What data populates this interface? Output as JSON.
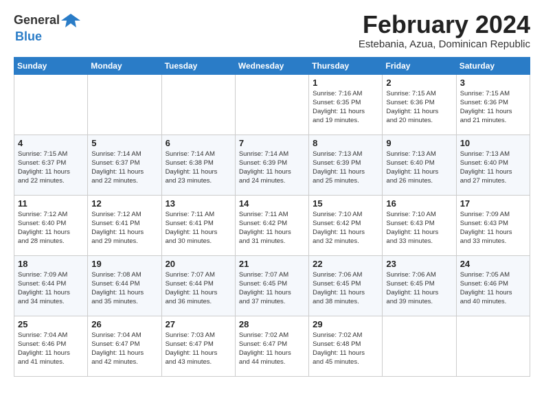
{
  "header": {
    "logo_line1": "General",
    "logo_line2": "Blue",
    "month": "February 2024",
    "location": "Estebania, Azua, Dominican Republic"
  },
  "days_of_week": [
    "Sunday",
    "Monday",
    "Tuesday",
    "Wednesday",
    "Thursday",
    "Friday",
    "Saturday"
  ],
  "weeks": [
    [
      {
        "day": "",
        "info": ""
      },
      {
        "day": "",
        "info": ""
      },
      {
        "day": "",
        "info": ""
      },
      {
        "day": "",
        "info": ""
      },
      {
        "day": "1",
        "info": "Sunrise: 7:16 AM\nSunset: 6:35 PM\nDaylight: 11 hours\nand 19 minutes."
      },
      {
        "day": "2",
        "info": "Sunrise: 7:15 AM\nSunset: 6:36 PM\nDaylight: 11 hours\nand 20 minutes."
      },
      {
        "day": "3",
        "info": "Sunrise: 7:15 AM\nSunset: 6:36 PM\nDaylight: 11 hours\nand 21 minutes."
      }
    ],
    [
      {
        "day": "4",
        "info": "Sunrise: 7:15 AM\nSunset: 6:37 PM\nDaylight: 11 hours\nand 22 minutes."
      },
      {
        "day": "5",
        "info": "Sunrise: 7:14 AM\nSunset: 6:37 PM\nDaylight: 11 hours\nand 22 minutes."
      },
      {
        "day": "6",
        "info": "Sunrise: 7:14 AM\nSunset: 6:38 PM\nDaylight: 11 hours\nand 23 minutes."
      },
      {
        "day": "7",
        "info": "Sunrise: 7:14 AM\nSunset: 6:39 PM\nDaylight: 11 hours\nand 24 minutes."
      },
      {
        "day": "8",
        "info": "Sunrise: 7:13 AM\nSunset: 6:39 PM\nDaylight: 11 hours\nand 25 minutes."
      },
      {
        "day": "9",
        "info": "Sunrise: 7:13 AM\nSunset: 6:40 PM\nDaylight: 11 hours\nand 26 minutes."
      },
      {
        "day": "10",
        "info": "Sunrise: 7:13 AM\nSunset: 6:40 PM\nDaylight: 11 hours\nand 27 minutes."
      }
    ],
    [
      {
        "day": "11",
        "info": "Sunrise: 7:12 AM\nSunset: 6:40 PM\nDaylight: 11 hours\nand 28 minutes."
      },
      {
        "day": "12",
        "info": "Sunrise: 7:12 AM\nSunset: 6:41 PM\nDaylight: 11 hours\nand 29 minutes."
      },
      {
        "day": "13",
        "info": "Sunrise: 7:11 AM\nSunset: 6:41 PM\nDaylight: 11 hours\nand 30 minutes."
      },
      {
        "day": "14",
        "info": "Sunrise: 7:11 AM\nSunset: 6:42 PM\nDaylight: 11 hours\nand 31 minutes."
      },
      {
        "day": "15",
        "info": "Sunrise: 7:10 AM\nSunset: 6:42 PM\nDaylight: 11 hours\nand 32 minutes."
      },
      {
        "day": "16",
        "info": "Sunrise: 7:10 AM\nSunset: 6:43 PM\nDaylight: 11 hours\nand 33 minutes."
      },
      {
        "day": "17",
        "info": "Sunrise: 7:09 AM\nSunset: 6:43 PM\nDaylight: 11 hours\nand 33 minutes."
      }
    ],
    [
      {
        "day": "18",
        "info": "Sunrise: 7:09 AM\nSunset: 6:44 PM\nDaylight: 11 hours\nand 34 minutes."
      },
      {
        "day": "19",
        "info": "Sunrise: 7:08 AM\nSunset: 6:44 PM\nDaylight: 11 hours\nand 35 minutes."
      },
      {
        "day": "20",
        "info": "Sunrise: 7:07 AM\nSunset: 6:44 PM\nDaylight: 11 hours\nand 36 minutes."
      },
      {
        "day": "21",
        "info": "Sunrise: 7:07 AM\nSunset: 6:45 PM\nDaylight: 11 hours\nand 37 minutes."
      },
      {
        "day": "22",
        "info": "Sunrise: 7:06 AM\nSunset: 6:45 PM\nDaylight: 11 hours\nand 38 minutes."
      },
      {
        "day": "23",
        "info": "Sunrise: 7:06 AM\nSunset: 6:45 PM\nDaylight: 11 hours\nand 39 minutes."
      },
      {
        "day": "24",
        "info": "Sunrise: 7:05 AM\nSunset: 6:46 PM\nDaylight: 11 hours\nand 40 minutes."
      }
    ],
    [
      {
        "day": "25",
        "info": "Sunrise: 7:04 AM\nSunset: 6:46 PM\nDaylight: 11 hours\nand 41 minutes."
      },
      {
        "day": "26",
        "info": "Sunrise: 7:04 AM\nSunset: 6:47 PM\nDaylight: 11 hours\nand 42 minutes."
      },
      {
        "day": "27",
        "info": "Sunrise: 7:03 AM\nSunset: 6:47 PM\nDaylight: 11 hours\nand 43 minutes."
      },
      {
        "day": "28",
        "info": "Sunrise: 7:02 AM\nSunset: 6:47 PM\nDaylight: 11 hours\nand 44 minutes."
      },
      {
        "day": "29",
        "info": "Sunrise: 7:02 AM\nSunset: 6:48 PM\nDaylight: 11 hours\nand 45 minutes."
      },
      {
        "day": "",
        "info": ""
      },
      {
        "day": "",
        "info": ""
      }
    ]
  ]
}
